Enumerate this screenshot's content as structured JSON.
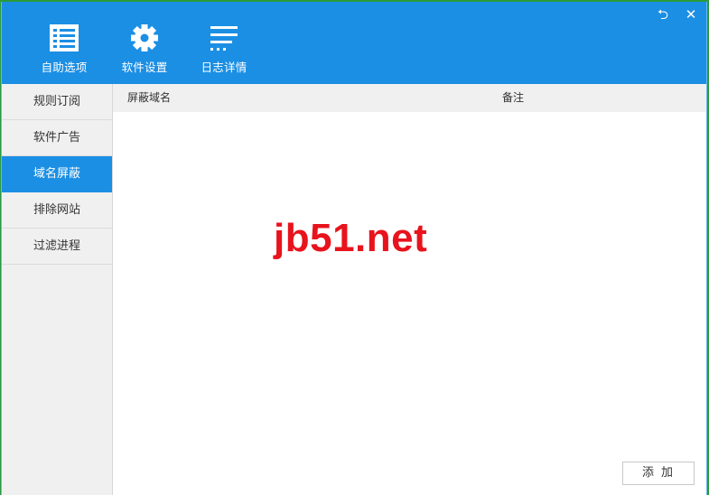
{
  "toolbar": {
    "items": [
      {
        "label": "自助选项",
        "icon": "checklist-icon"
      },
      {
        "label": "软件设置",
        "icon": "gear-icon"
      },
      {
        "label": "日志详情",
        "icon": "log-lines-icon"
      }
    ]
  },
  "window_controls": {
    "restore": "⮌",
    "close": "✕"
  },
  "sidebar": {
    "items": [
      {
        "label": "规则订阅"
      },
      {
        "label": "软件广告"
      },
      {
        "label": "域名屏蔽",
        "active": true
      },
      {
        "label": "排除网站"
      },
      {
        "label": "过滤进程"
      }
    ]
  },
  "table": {
    "columns": [
      "屏蔽域名",
      "备注"
    ]
  },
  "watermark": "jb51.net",
  "add_button": "添加",
  "colors": {
    "accent": "#1b8fe4",
    "sidebar_bg": "#f0f0f0",
    "watermark": "#e8131c"
  }
}
